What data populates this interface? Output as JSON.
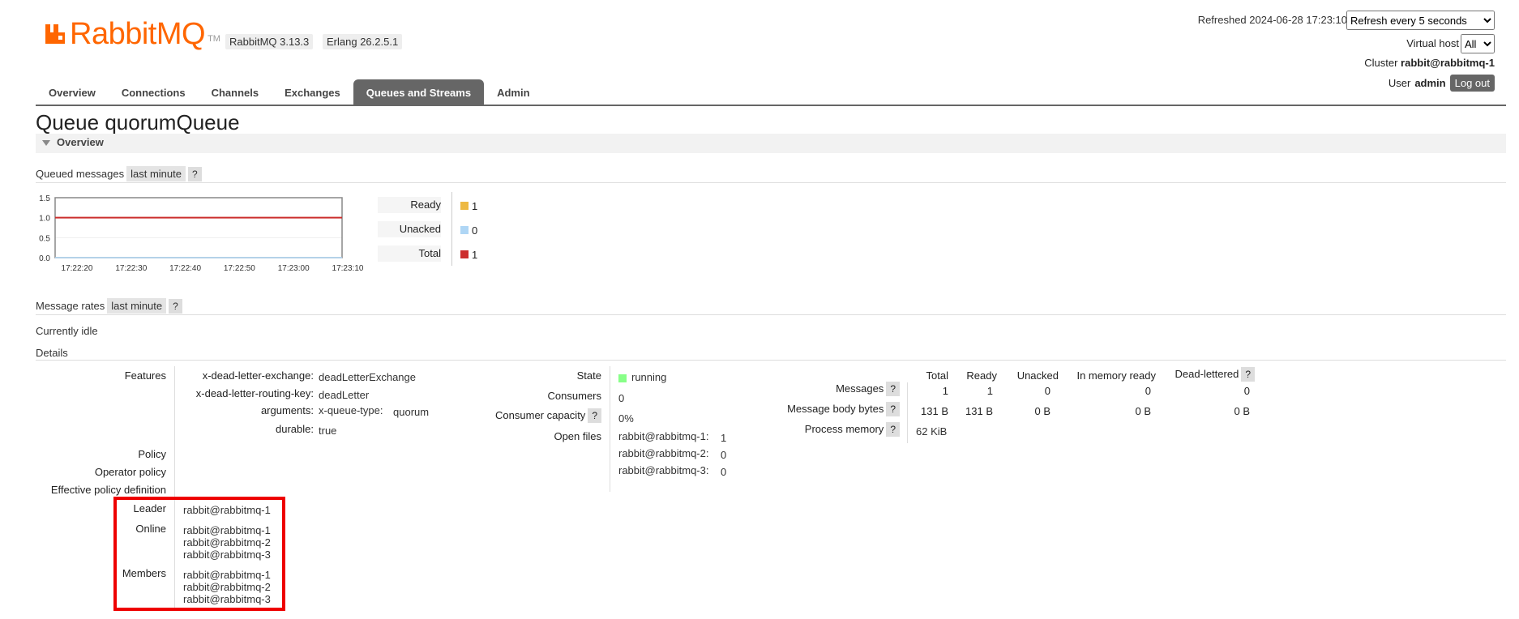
{
  "header": {
    "logo_text": "RabbitMQ",
    "logo_tm": "TM",
    "rabbitmq_version": "RabbitMQ 3.13.3",
    "erlang_version": "Erlang 26.2.5.1",
    "refreshed": "Refreshed 2024-06-28 17:23:10",
    "refresh_option": "Refresh every 5 seconds",
    "virtual_host_label": "Virtual host",
    "virtual_host_value": "All",
    "cluster_label": "Cluster",
    "cluster_value": "rabbit@rabbitmq-1",
    "user_label": "User",
    "user_value": "admin",
    "logout_label": "Log out"
  },
  "nav": {
    "tabs": [
      {
        "label": "Overview"
      },
      {
        "label": "Connections"
      },
      {
        "label": "Channels"
      },
      {
        "label": "Exchanges"
      },
      {
        "label": "Queues and Streams",
        "active": true
      },
      {
        "label": "Admin"
      }
    ]
  },
  "page": {
    "title_prefix": "Queue",
    "title_name": "quorumQueue",
    "section_overview": "Overview"
  },
  "queued_messages": {
    "label": "Queued messages",
    "range": "last minute",
    "help": "?",
    "chart_data": {
      "type": "line",
      "x": [
        "17:22:20",
        "17:22:30",
        "17:22:40",
        "17:22:50",
        "17:23:00",
        "17:23:10"
      ],
      "series": [
        {
          "name": "Ready",
          "values": [
            1,
            1,
            1,
            1,
            1,
            1
          ],
          "color": "#edb943"
        },
        {
          "name": "Unacked",
          "values": [
            0,
            0,
            0,
            0,
            0,
            0
          ],
          "color": "#afd6f5"
        },
        {
          "name": "Total",
          "values": [
            1,
            1,
            1,
            1,
            1,
            1
          ],
          "color": "#cc2e2e"
        }
      ],
      "y_ticks": [
        "1.5",
        "1.0",
        "0.5",
        "0.0"
      ],
      "ylim": [
        0,
        1.5
      ],
      "grid": true
    },
    "legend": [
      {
        "label": "Ready",
        "value": "1",
        "color": "#edb943"
      },
      {
        "label": "Unacked",
        "value": "0",
        "color": "#afd6f5"
      },
      {
        "label": "Total",
        "value": "1",
        "color": "#cc2e2e"
      }
    ]
  },
  "message_rates": {
    "label": "Message rates",
    "range": "last minute",
    "help": "?",
    "status": "Currently idle"
  },
  "details": {
    "label": "Details",
    "features_label": "Features",
    "features": [
      {
        "key": "x-dead-letter-exchange:",
        "value": "deadLetterExchange"
      },
      {
        "key": "x-dead-letter-routing-key:",
        "value": "deadLetter"
      },
      {
        "key": "arguments:",
        "value": "x-queue-type:",
        "extra": "quorum"
      },
      {
        "key": "durable:",
        "value": "true"
      }
    ],
    "policy_label": "Policy",
    "operator_policy_label": "Operator policy",
    "effective_policy_label": "Effective policy definition",
    "leader_label": "Leader",
    "leader": "rabbit@rabbitmq-1",
    "online_label": "Online",
    "online": [
      "rabbit@rabbitmq-1",
      "rabbit@rabbitmq-2",
      "rabbit@rabbitmq-3"
    ],
    "members_label": "Members",
    "members": [
      "rabbit@rabbitmq-1",
      "rabbit@rabbitmq-2",
      "rabbit@rabbitmq-3"
    ],
    "state_label": "State",
    "state": "running",
    "consumers_label": "Consumers",
    "consumers": "0",
    "consumer_capacity_label": "Consumer capacity",
    "consumer_capacity": "0%",
    "open_files_label": "Open files",
    "open_files": [
      {
        "node": "rabbit@rabbitmq-1:",
        "value": "1"
      },
      {
        "node": "rabbit@rabbitmq-2:",
        "value": "0"
      },
      {
        "node": "rabbit@rabbitmq-3:",
        "value": "0"
      }
    ],
    "stats_headers": [
      "Total",
      "Ready",
      "Unacked",
      "In memory ready",
      "Dead-lettered"
    ],
    "messages_label": "Messages",
    "messages": [
      "1",
      "1",
      "0",
      "0",
      "0"
    ],
    "body_bytes_label": "Message body bytes",
    "body_bytes": [
      "131 B",
      "131 B",
      "0 B",
      "0 B",
      "0 B"
    ],
    "process_memory_label": "Process memory",
    "process_memory": "62 KiB",
    "help": "?"
  }
}
